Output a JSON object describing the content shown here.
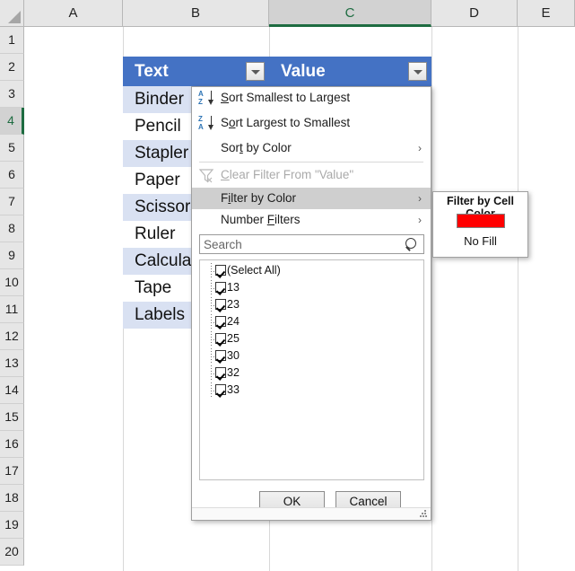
{
  "spreadsheet": {
    "column_headers": [
      "A",
      "B",
      "C",
      "D",
      "E"
    ],
    "selected_column": "C",
    "row_headers": [
      "1",
      "2",
      "3",
      "4",
      "5",
      "6",
      "7",
      "8",
      "9",
      "10",
      "11",
      "12",
      "13",
      "14",
      "15",
      "16",
      "17",
      "18",
      "19",
      "20"
    ],
    "selected_row": "4",
    "active_cell": "C4"
  },
  "table": {
    "headers": [
      "Text",
      "Value"
    ],
    "rows": [
      {
        "text": "Binder",
        "value": ""
      },
      {
        "text": "Pencil",
        "value": ""
      },
      {
        "text": "Stapler",
        "value": ""
      },
      {
        "text": "Paper",
        "value": ""
      },
      {
        "text": "Scissors",
        "value": ""
      },
      {
        "text": "Ruler",
        "value": ""
      },
      {
        "text": "Calculator",
        "value": ""
      },
      {
        "text": "Tape",
        "value": ""
      },
      {
        "text": "Labels",
        "value": ""
      }
    ]
  },
  "filter_menu": {
    "items": [
      {
        "label": "Sort Smallest to Largest",
        "accel": "S",
        "icon": "sort-ascending-icon",
        "has_submenu": false,
        "disabled": false,
        "highlighted": false
      },
      {
        "label": "Sort Largest to Smallest",
        "accel": "o",
        "icon": "sort-descending-icon",
        "has_submenu": false,
        "disabled": false,
        "highlighted": false
      },
      {
        "label": "Sort by Color",
        "accel": "t",
        "icon": "",
        "has_submenu": true,
        "disabled": false,
        "highlighted": false
      },
      {
        "label": "Clear Filter From \"Value\"",
        "accel": "C",
        "icon": "clear-filter-icon",
        "has_submenu": false,
        "disabled": true,
        "highlighted": false
      },
      {
        "label": "Filter by Color",
        "accel": "i",
        "icon": "",
        "has_submenu": true,
        "disabled": false,
        "highlighted": true
      },
      {
        "label": "Number Filters",
        "accel": "F",
        "icon": "",
        "has_submenu": true,
        "disabled": false,
        "highlighted": false
      }
    ],
    "submenu_arrow": "›",
    "search": {
      "placeholder": "Search",
      "value": ""
    },
    "checkbox_items": [
      {
        "label": "(Select All)",
        "checked": true
      },
      {
        "label": "13",
        "checked": true
      },
      {
        "label": "23",
        "checked": true
      },
      {
        "label": "24",
        "checked": true
      },
      {
        "label": "25",
        "checked": true
      },
      {
        "label": "30",
        "checked": true
      },
      {
        "label": "32",
        "checked": true
      },
      {
        "label": "33",
        "checked": true
      }
    ],
    "ok_label": "OK",
    "cancel_label": "Cancel"
  },
  "color_submenu": {
    "title": "Filter by Cell Color",
    "swatch_color": "#FF0000",
    "no_fill_label": "No Fill"
  },
  "colors": {
    "table_header_blue": "#4472C4",
    "band_row_blue": "#D9E1F2",
    "selection_green": "#1E6C41",
    "menu_highlight": "#CFCFCF"
  }
}
